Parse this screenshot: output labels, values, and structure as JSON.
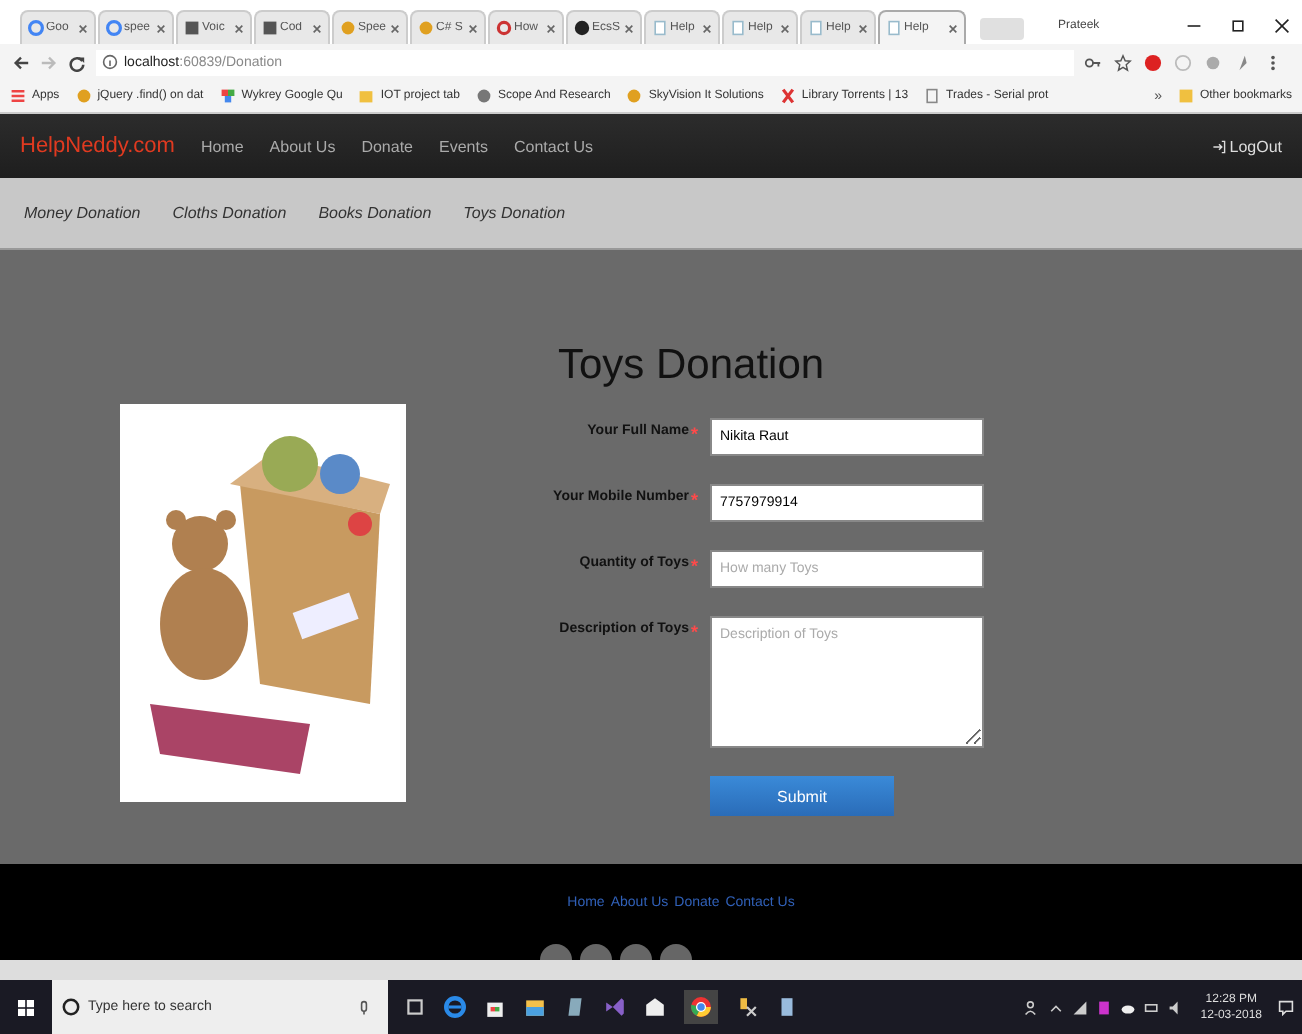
{
  "browser": {
    "tabs": [
      {
        "label": "Goo",
        "selected": false
      },
      {
        "label": "spee",
        "selected": false
      },
      {
        "label": "Voic",
        "selected": false
      },
      {
        "label": "Cod",
        "selected": false
      },
      {
        "label": "Spee",
        "selected": false
      },
      {
        "label": "C# S",
        "selected": false
      },
      {
        "label": "How",
        "selected": false
      },
      {
        "label": "EcsS",
        "selected": false
      },
      {
        "label": "Help",
        "selected": false
      },
      {
        "label": "Help",
        "selected": false
      },
      {
        "label": "Help",
        "selected": false
      },
      {
        "label": "Help",
        "selected": true
      }
    ],
    "profile": "Prateek",
    "address": {
      "host": "localhost",
      "path": ":60839/Donation"
    },
    "bookmarks": [
      {
        "label": "Apps"
      },
      {
        "label": "jQuery .find() on dat"
      },
      {
        "label": "Wykrey Google Qu"
      },
      {
        "label": "IOT project tab"
      },
      {
        "label": "Scope And Research"
      },
      {
        "label": "SkyVision It Solutions"
      },
      {
        "label": "Library Torrents | 13"
      },
      {
        "label": "Trades - Serial prot"
      }
    ],
    "more": "»",
    "other": "Other bookmarks"
  },
  "site": {
    "brand": "HelpNeddy.com",
    "nav": [
      "Home",
      "About Us",
      "Donate",
      "Events",
      "Contact Us"
    ],
    "logout": "LogOut",
    "subnav": [
      "Money Donation",
      "Cloths Donation",
      "Books Donation",
      "Toys Donation"
    ]
  },
  "form": {
    "title": "Toys Donation",
    "fields": [
      {
        "label": "Your Full Name",
        "required_mark": "*",
        "kind": "input",
        "value": "Nikita Raut"
      },
      {
        "label": "Your Mobile Number",
        "required_mark": "*",
        "kind": "input",
        "value": "7757979914"
      },
      {
        "label": "Quantity of Toys",
        "required_mark": "*",
        "kind": "input",
        "placeholder": "How many Toys"
      },
      {
        "label": "Description of Toys",
        "required_mark": "*",
        "kind": "textarea",
        "placeholder": "Description of Toys"
      }
    ],
    "submit": "Submit"
  },
  "footer": {
    "links": [
      "Home",
      "About Us",
      "Donate",
      "Contact Us"
    ]
  },
  "taskbar": {
    "search": {
      "placeholder": "Type here to search"
    },
    "time": "12:28 PM",
    "date": "12-03-2018"
  }
}
